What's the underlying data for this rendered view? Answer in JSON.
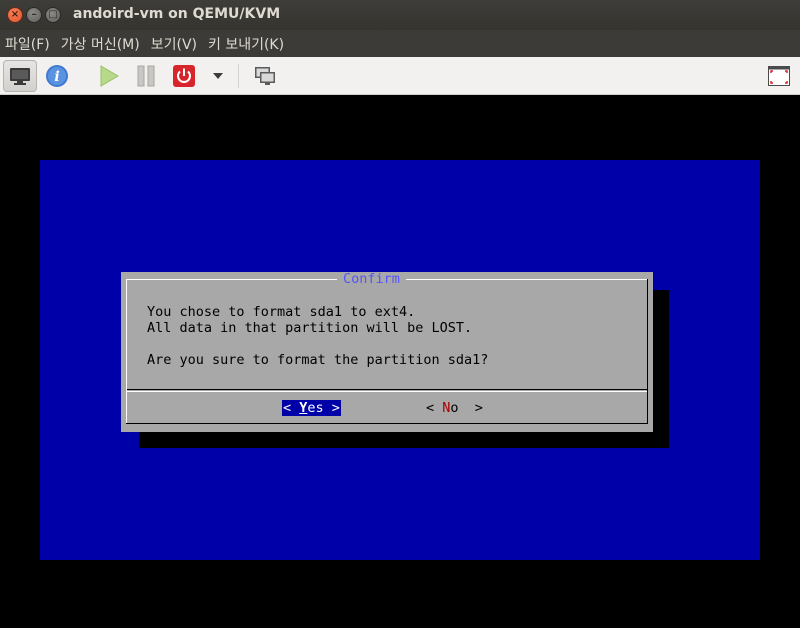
{
  "window": {
    "title": "andoird-vm on QEMU/KVM",
    "close_glyph": "×",
    "minimize_glyph": "–",
    "maximize_glyph": "□"
  },
  "menubar": {
    "items": [
      "파일(F)",
      "가상 머신(M)",
      "보기(V)",
      "키 보내기(K)"
    ]
  },
  "toolbar": {
    "icons": [
      "console-screen-icon",
      "info-icon",
      "play-icon",
      "pause-icon",
      "power-icon",
      "dropdown-arrow-icon",
      "multi-monitor-icon",
      "fullscreen-icon"
    ],
    "info_glyph": "i"
  },
  "dialog": {
    "title": "Confirm",
    "lines": [
      "You chose to format sda1 to ext4.",
      "All data in that partition will be LOST.",
      "Are you sure to format the partition sda1?"
    ],
    "yes_button": {
      "left": "< ",
      "hot": "Y",
      "rest": "es",
      "right": " >"
    },
    "no_button": {
      "left": "< ",
      "hot": "N",
      "rest": "o",
      "right": "  >"
    }
  },
  "colors": {
    "console_blue": "#0000a8",
    "dialog_gray": "#a8a8a8",
    "title_color": "#5454fc",
    "hotkey_red": "#a80000"
  }
}
